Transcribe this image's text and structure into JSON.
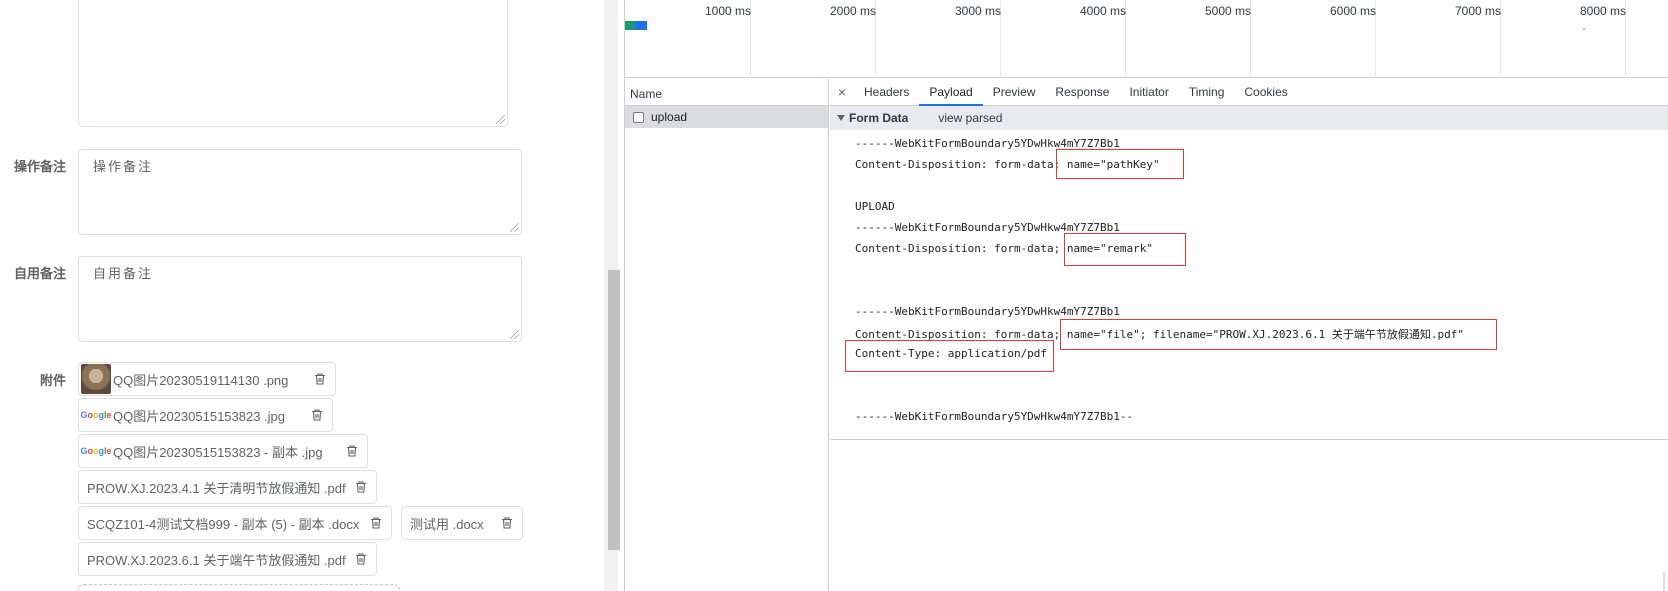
{
  "form": {
    "op_remark_label": "操作备注",
    "op_remark_placeholder": "操作备注",
    "self_remark_label": "自用备注",
    "self_remark_placeholder": "自用备注",
    "attachments_label": "附件",
    "attachments": [
      {
        "name": "QQ图片20230519114130 .png",
        "thumb": "photo"
      },
      {
        "name": "QQ图片20230515153823 .jpg",
        "thumb": "google"
      },
      {
        "name": "QQ图片20230515153823 - 副本 .jpg",
        "thumb": "google"
      },
      {
        "name": "PROW.XJ.2023.4.1 关于清明节放假通知 .pdf",
        "thumb": "none"
      },
      {
        "name": "SCQZ101-4测试文档999 - 副本 (5) - 副本 .docx",
        "thumb": "none"
      },
      {
        "name": "测试用 .docx",
        "thumb": "none"
      },
      {
        "name": "PROW.XJ.2023.6.1 关于端午节放假通知 .pdf",
        "thumb": "none"
      }
    ]
  },
  "devtools": {
    "timeline_ticks": [
      "1000 ms",
      "2000 ms",
      "3000 ms",
      "4000 ms",
      "5000 ms",
      "6000 ms",
      "7000 ms",
      "8000 ms"
    ],
    "name_header": "Name",
    "request_name": "upload",
    "close_glyph": "×",
    "tabs": [
      "Headers",
      "Payload",
      "Preview",
      "Response",
      "Initiator",
      "Timing",
      "Cookies"
    ],
    "active_tab": "Payload",
    "section_title": "Form Data",
    "view_parsed": "view parsed",
    "payload_lines": [
      "------WebKitFormBoundary5YDwHkw4mY7Z7Bb1",
      "Content-Disposition: form-data; name=\"pathKey\"",
      "UPLOAD",
      "------WebKitFormBoundary5YDwHkw4mY7Z7Bb1",
      "Content-Disposition: form-data; name=\"remark\"",
      "------WebKitFormBoundary5YDwHkw4mY7Z7Bb1",
      "Content-Disposition: form-data; name=\"file\"; filename=\"PROW.XJ.2023.6.1 关于端午节放假通知.pdf\"",
      "Content-Type: application/pdf",
      "------WebKitFormBoundary5YDwHkw4mY7Z7Bb1--"
    ]
  },
  "colors": {
    "highlight_box": "#e53935",
    "active_tab_underline": "#1a73e8"
  }
}
